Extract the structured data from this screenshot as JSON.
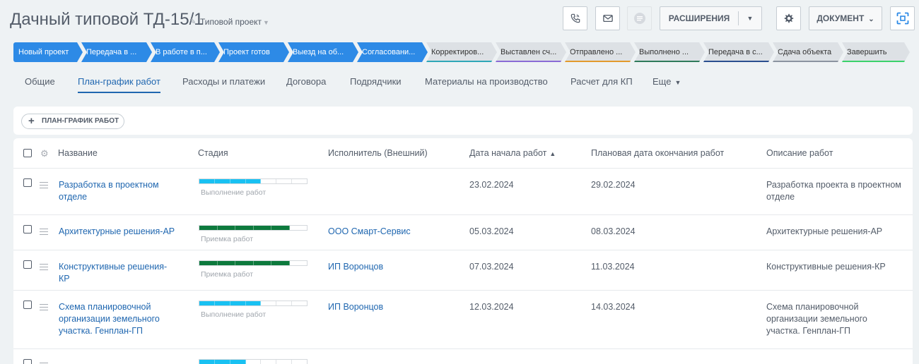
{
  "header": {
    "title": "Дачный типовой ТД-15/1",
    "template": "Типовой проект",
    "extensions_label": "РАСШИРЕНИЯ",
    "document_label": "ДОКУМЕНТ"
  },
  "stages": [
    {
      "label": "Новый проект",
      "state": "active"
    },
    {
      "label": "Передача в ...",
      "state": "active"
    },
    {
      "label": "В работе в п...",
      "state": "active"
    },
    {
      "label": "Проект готов",
      "state": "active"
    },
    {
      "label": "Выезд на об...",
      "state": "active"
    },
    {
      "label": "Согласовани...",
      "state": "active"
    },
    {
      "label": "Корректиров...",
      "state": "inactive",
      "color": "#2fa8b8"
    },
    {
      "label": "Выставлен сч...",
      "state": "inactive",
      "color": "#8a6bd6"
    },
    {
      "label": "Отправлено ...",
      "state": "inactive",
      "color": "#e39a2c"
    },
    {
      "label": "Выполнено ...",
      "state": "inactive",
      "color": "#2f7b5b"
    },
    {
      "label": "Передача в с...",
      "state": "inactive",
      "color": "#2a4f8f"
    },
    {
      "label": "Сдача объекта",
      "state": "inactive",
      "color": "#8b94a0"
    },
    {
      "label": "Завершить",
      "state": "inactive",
      "color": "#3ad26b"
    }
  ],
  "tabs": [
    {
      "label": "Общие",
      "active": false
    },
    {
      "label": "План-график работ",
      "active": true
    },
    {
      "label": "Расходы и платежи",
      "active": false
    },
    {
      "label": "Договора",
      "active": false
    },
    {
      "label": "Подрядчики",
      "active": false
    },
    {
      "label": "Материалы на производство",
      "active": false
    },
    {
      "label": "Расчет для КП",
      "active": false
    },
    {
      "label": "Еще",
      "active": false
    }
  ],
  "toolbar": {
    "add_label": "ПЛАН-ГРАФИК РАБОТ"
  },
  "grid": {
    "columns": [
      "Название",
      "Стадия",
      "Исполнитель (Внешний)",
      "Дата начала работ",
      "Плановая дата окончания работ",
      "Описание работ"
    ],
    "rows": [
      {
        "name": "Разработка в проектном отделе",
        "stage": "Выполнение работ",
        "progress_segments": 4,
        "stage_color": "#19c1f2",
        "executor": "",
        "start": "23.02.2024",
        "end": "29.02.2024",
        "description": "Разработка проекта в проектном отделе"
      },
      {
        "name": "Архитектурные решения-АР",
        "stage": "Приемка работ",
        "progress_segments": 5,
        "stage_color": "#0d7a3d",
        "executor": "ООО Смарт-Сервис",
        "start": "05.03.2024",
        "end": "08.03.2024",
        "description": "Архитектурные решения-АР"
      },
      {
        "name": "Конструктивные решения-КР",
        "stage": "Приемка работ",
        "progress_segments": 5,
        "stage_color": "#0d7a3d",
        "executor": "ИП Воронцов",
        "start": "07.03.2024",
        "end": "11.03.2024",
        "description": "Конструктивные решения-КР"
      },
      {
        "name": "Схема планировочной организации земельного участка. Генплан-ГП",
        "stage": "Выполнение работ",
        "progress_segments": 4,
        "stage_color": "#19c1f2",
        "executor": "ИП Воронцов",
        "start": "12.03.2024",
        "end": "14.03.2024",
        "description": "Схема планировочной организации земельного участка. Генплан-ГП"
      }
    ]
  },
  "icons": [
    "edit-icon",
    "phone-icon",
    "mail-icon",
    "chat-icon",
    "gear-icon",
    "scan-icon",
    "plus-icon",
    "drag-handle-icon",
    "sort-asc-icon"
  ]
}
